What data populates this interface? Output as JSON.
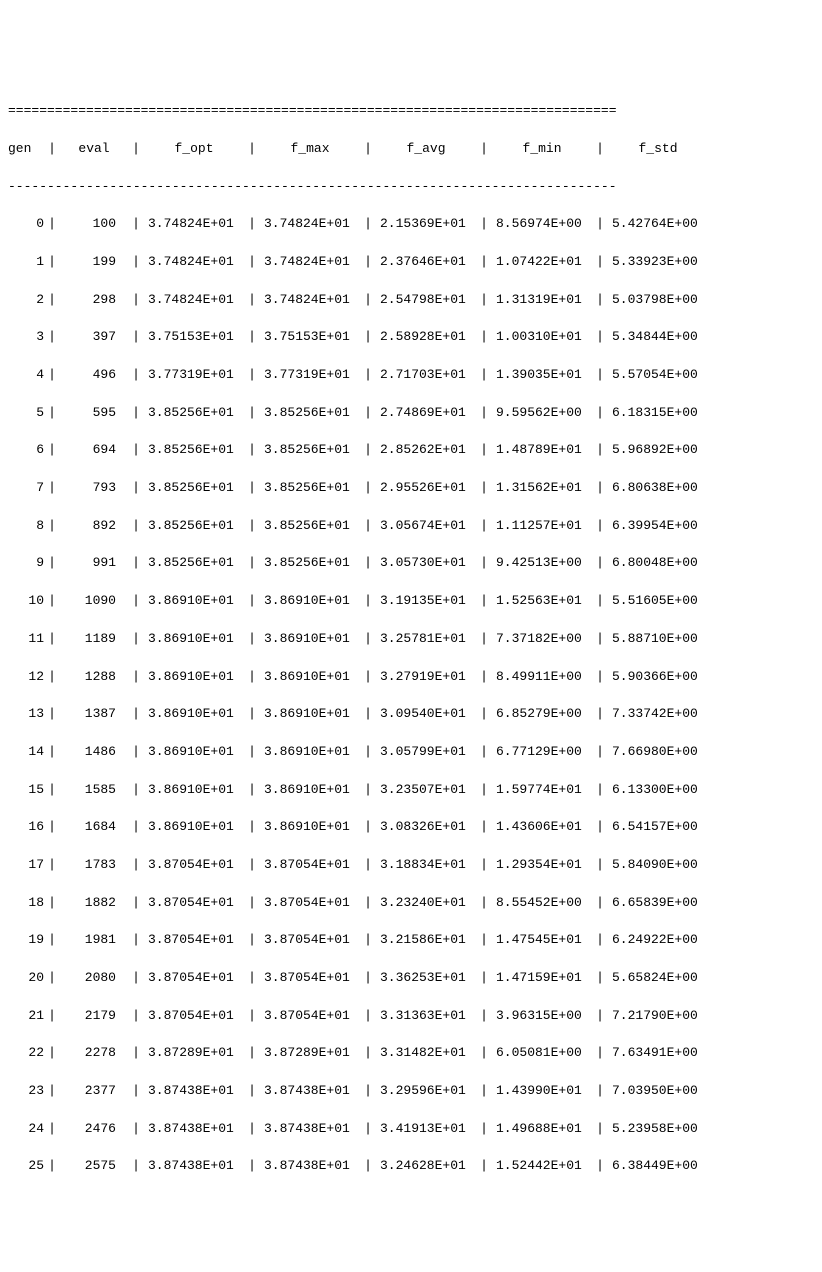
{
  "border": {
    "top": "==============================================================================",
    "sep": "------------------------------------------------------------------------------"
  },
  "headers": {
    "gen": "gen",
    "eval": "eval",
    "f_opt": "f_opt",
    "f_max": "f_max",
    "f_avg": "f_avg",
    "f_min": "f_min",
    "f_std": "f_std"
  },
  "pipe": "|",
  "rows": [
    {
      "gen": "0",
      "eval": "100",
      "f_opt": "3.74824E+01",
      "f_max": "3.74824E+01",
      "f_avg": "2.15369E+01",
      "f_min": "8.56974E+00",
      "f_std": "5.42764E+00"
    },
    {
      "gen": "1",
      "eval": "199",
      "f_opt": "3.74824E+01",
      "f_max": "3.74824E+01",
      "f_avg": "2.37646E+01",
      "f_min": "1.07422E+01",
      "f_std": "5.33923E+00"
    },
    {
      "gen": "2",
      "eval": "298",
      "f_opt": "3.74824E+01",
      "f_max": "3.74824E+01",
      "f_avg": "2.54798E+01",
      "f_min": "1.31319E+01",
      "f_std": "5.03798E+00"
    },
    {
      "gen": "3",
      "eval": "397",
      "f_opt": "3.75153E+01",
      "f_max": "3.75153E+01",
      "f_avg": "2.58928E+01",
      "f_min": "1.00310E+01",
      "f_std": "5.34844E+00"
    },
    {
      "gen": "4",
      "eval": "496",
      "f_opt": "3.77319E+01",
      "f_max": "3.77319E+01",
      "f_avg": "2.71703E+01",
      "f_min": "1.39035E+01",
      "f_std": "5.57054E+00"
    },
    {
      "gen": "5",
      "eval": "595",
      "f_opt": "3.85256E+01",
      "f_max": "3.85256E+01",
      "f_avg": "2.74869E+01",
      "f_min": "9.59562E+00",
      "f_std": "6.18315E+00"
    },
    {
      "gen": "6",
      "eval": "694",
      "f_opt": "3.85256E+01",
      "f_max": "3.85256E+01",
      "f_avg": "2.85262E+01",
      "f_min": "1.48789E+01",
      "f_std": "5.96892E+00"
    },
    {
      "gen": "7",
      "eval": "793",
      "f_opt": "3.85256E+01",
      "f_max": "3.85256E+01",
      "f_avg": "2.95526E+01",
      "f_min": "1.31562E+01",
      "f_std": "6.80638E+00"
    },
    {
      "gen": "8",
      "eval": "892",
      "f_opt": "3.85256E+01",
      "f_max": "3.85256E+01",
      "f_avg": "3.05674E+01",
      "f_min": "1.11257E+01",
      "f_std": "6.39954E+00"
    },
    {
      "gen": "9",
      "eval": "991",
      "f_opt": "3.85256E+01",
      "f_max": "3.85256E+01",
      "f_avg": "3.05730E+01",
      "f_min": "9.42513E+00",
      "f_std": "6.80048E+00"
    },
    {
      "gen": "10",
      "eval": "1090",
      "f_opt": "3.86910E+01",
      "f_max": "3.86910E+01",
      "f_avg": "3.19135E+01",
      "f_min": "1.52563E+01",
      "f_std": "5.51605E+00"
    },
    {
      "gen": "11",
      "eval": "1189",
      "f_opt": "3.86910E+01",
      "f_max": "3.86910E+01",
      "f_avg": "3.25781E+01",
      "f_min": "7.37182E+00",
      "f_std": "5.88710E+00"
    },
    {
      "gen": "12",
      "eval": "1288",
      "f_opt": "3.86910E+01",
      "f_max": "3.86910E+01",
      "f_avg": "3.27919E+01",
      "f_min": "8.49911E+00",
      "f_std": "5.90366E+00"
    },
    {
      "gen": "13",
      "eval": "1387",
      "f_opt": "3.86910E+01",
      "f_max": "3.86910E+01",
      "f_avg": "3.09540E+01",
      "f_min": "6.85279E+00",
      "f_std": "7.33742E+00"
    },
    {
      "gen": "14",
      "eval": "1486",
      "f_opt": "3.86910E+01",
      "f_max": "3.86910E+01",
      "f_avg": "3.05799E+01",
      "f_min": "6.77129E+00",
      "f_std": "7.66980E+00"
    },
    {
      "gen": "15",
      "eval": "1585",
      "f_opt": "3.86910E+01",
      "f_max": "3.86910E+01",
      "f_avg": "3.23507E+01",
      "f_min": "1.59774E+01",
      "f_std": "6.13300E+00"
    },
    {
      "gen": "16",
      "eval": "1684",
      "f_opt": "3.86910E+01",
      "f_max": "3.86910E+01",
      "f_avg": "3.08326E+01",
      "f_min": "1.43606E+01",
      "f_std": "6.54157E+00"
    },
    {
      "gen": "17",
      "eval": "1783",
      "f_opt": "3.87054E+01",
      "f_max": "3.87054E+01",
      "f_avg": "3.18834E+01",
      "f_min": "1.29354E+01",
      "f_std": "5.84090E+00"
    },
    {
      "gen": "18",
      "eval": "1882",
      "f_opt": "3.87054E+01",
      "f_max": "3.87054E+01",
      "f_avg": "3.23240E+01",
      "f_min": "8.55452E+00",
      "f_std": "6.65839E+00"
    },
    {
      "gen": "19",
      "eval": "1981",
      "f_opt": "3.87054E+01",
      "f_max": "3.87054E+01",
      "f_avg": "3.21586E+01",
      "f_min": "1.47545E+01",
      "f_std": "6.24922E+00"
    },
    {
      "gen": "20",
      "eval": "2080",
      "f_opt": "3.87054E+01",
      "f_max": "3.87054E+01",
      "f_avg": "3.36253E+01",
      "f_min": "1.47159E+01",
      "f_std": "5.65824E+00"
    },
    {
      "gen": "21",
      "eval": "2179",
      "f_opt": "3.87054E+01",
      "f_max": "3.87054E+01",
      "f_avg": "3.31363E+01",
      "f_min": "3.96315E+00",
      "f_std": "7.21790E+00"
    },
    {
      "gen": "22",
      "eval": "2278",
      "f_opt": "3.87289E+01",
      "f_max": "3.87289E+01",
      "f_avg": "3.31482E+01",
      "f_min": "6.05081E+00",
      "f_std": "7.63491E+00"
    },
    {
      "gen": "23",
      "eval": "2377",
      "f_opt": "3.87438E+01",
      "f_max": "3.87438E+01",
      "f_avg": "3.29596E+01",
      "f_min": "1.43990E+01",
      "f_std": "7.03950E+00"
    },
    {
      "gen": "24",
      "eval": "2476",
      "f_opt": "3.87438E+01",
      "f_max": "3.87438E+01",
      "f_avg": "3.41913E+01",
      "f_min": "1.49688E+01",
      "f_std": "5.23958E+00"
    },
    {
      "gen": "25",
      "eval": "2575",
      "f_opt": "3.87438E+01",
      "f_max": "3.87438E+01",
      "f_avg": "3.24628E+01",
      "f_min": "1.52442E+01",
      "f_std": "6.38449E+00"
    }
  ]
}
